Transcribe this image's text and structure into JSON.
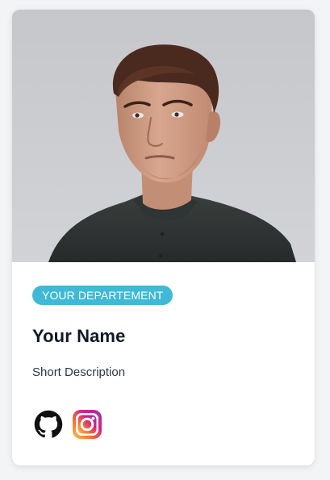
{
  "profile": {
    "department": "YOUR DEPARTEMENT",
    "name": "Your Name",
    "description": "Short Description"
  },
  "social": [
    {
      "icon": "github-icon"
    },
    {
      "icon": "instagram-icon"
    }
  ],
  "colors": {
    "badge": "#3fb9d5",
    "name": "#111827",
    "description": "#2d3748",
    "card": "#ffffff",
    "page": "#f3f4f6"
  }
}
